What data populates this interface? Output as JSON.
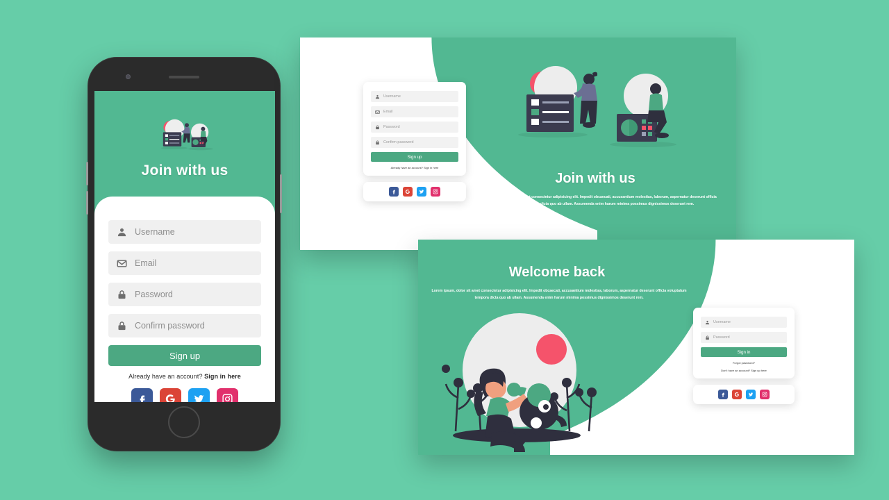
{
  "theme": {
    "page_background": "#66cda8",
    "panel_green": "#52b892",
    "button_green": "#4ca882",
    "field_gray": "#f0f0f0",
    "placeholder_gray": "#8e8e8e",
    "accent_red": "#f5536b"
  },
  "mobile": {
    "hero_title": "Join with us",
    "fields": [
      {
        "icon": "user-icon",
        "placeholder": "Username",
        "value": ""
      },
      {
        "icon": "envelope-icon",
        "placeholder": "Email",
        "value": ""
      },
      {
        "icon": "lock-icon",
        "placeholder": "Password",
        "value": ""
      },
      {
        "icon": "lock-icon",
        "placeholder": "Confirm password",
        "value": ""
      }
    ],
    "submit_label": "Sign up",
    "note_prefix": "Already have an account? ",
    "note_link": "Sign in here",
    "socials": [
      {
        "name": "facebook",
        "glyph": "f",
        "color": "#3b5998"
      },
      {
        "name": "google",
        "glyph": "G",
        "color": "#db4437"
      },
      {
        "name": "twitter",
        "glyph": "t",
        "color": "#1da1f2"
      },
      {
        "name": "instagram",
        "glyph": "i",
        "color": "#e1306c"
      }
    ]
  },
  "desktop_signup": {
    "title": "Join with us",
    "lorem": "Lorem ipsum, dolor sit amet consectetur adipisicing elit. Impedit obcaecati, accusantium molestias, laborum, aspernatur deserunt officia voluptatum tempora dicta quo ab ullam. Assumenda enim harum minima possimus dignissimos deserunt rem.",
    "fields": [
      {
        "icon": "user-icon",
        "placeholder": "Username",
        "value": ""
      },
      {
        "icon": "envelope-icon",
        "placeholder": "Email",
        "value": ""
      },
      {
        "icon": "lock-icon",
        "placeholder": "Password",
        "value": ""
      },
      {
        "icon": "lock-icon",
        "placeholder": "Confirm password",
        "value": ""
      }
    ],
    "submit_label": "Sign up",
    "note": "Already have an account? Sign in here",
    "socials": [
      {
        "name": "facebook",
        "glyph": "f",
        "color": "#3b5998"
      },
      {
        "name": "google",
        "glyph": "G",
        "color": "#db4437"
      },
      {
        "name": "twitter",
        "glyph": "t",
        "color": "#1da1f2"
      },
      {
        "name": "instagram",
        "glyph": "i",
        "color": "#e1306c"
      }
    ]
  },
  "desktop_signin": {
    "title": "Welcome back",
    "lorem": "Lorem ipsum, dolor sit amet consectetur adipisicing elit. Impedit obcaecati, accusantium molestias, laborum, aspernatur deserunt officia voluptatum tempora dicta quo ab ullam. Assumenda enim harum minima possimus dignissimos deserunt rem.",
    "fields": [
      {
        "icon": "user-icon",
        "placeholder": "Username",
        "value": ""
      },
      {
        "icon": "lock-icon",
        "placeholder": "Password",
        "value": ""
      }
    ],
    "submit_label": "Sign in",
    "forgot_label": "Forgot password?",
    "note": "Don't have an account? Sign up here",
    "socials": [
      {
        "name": "facebook",
        "glyph": "f",
        "color": "#3b5998"
      },
      {
        "name": "google",
        "glyph": "G",
        "color": "#db4437"
      },
      {
        "name": "twitter",
        "glyph": "t",
        "color": "#1da1f2"
      },
      {
        "name": "instagram",
        "glyph": "i",
        "color": "#e1306c"
      }
    ]
  }
}
